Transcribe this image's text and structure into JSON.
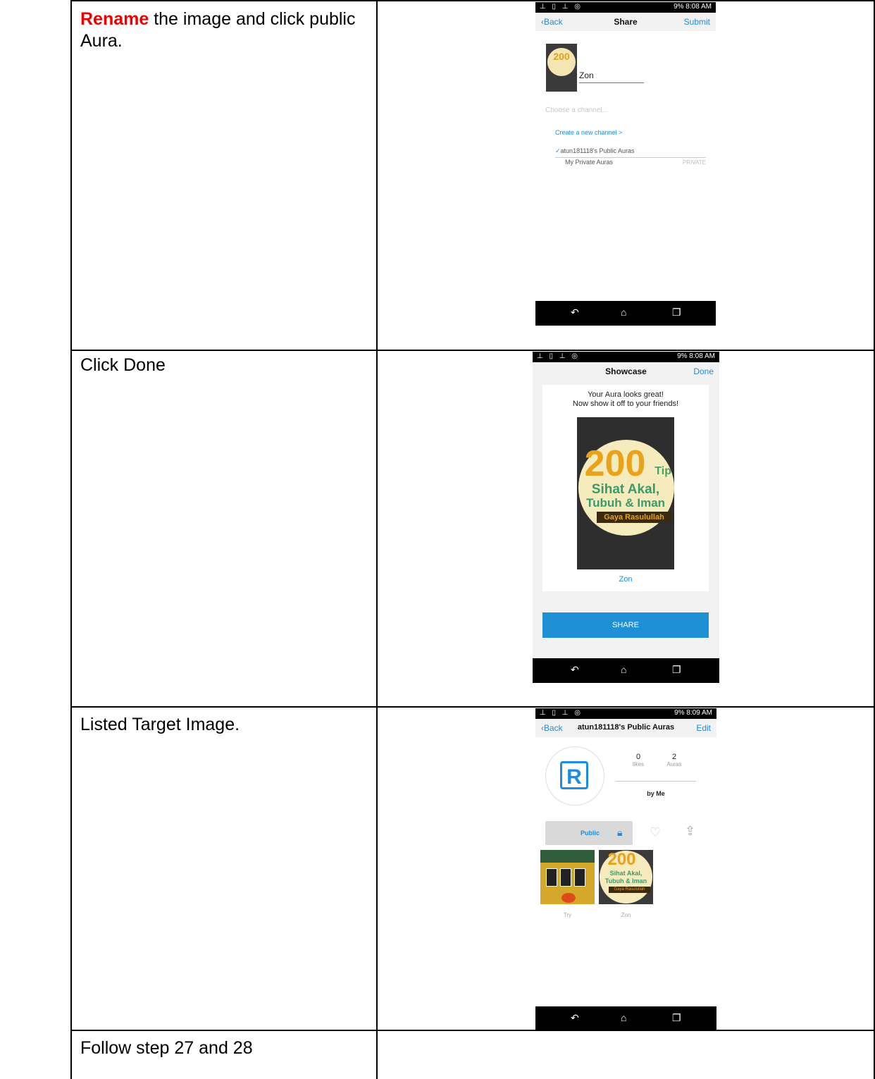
{
  "rows": [
    {
      "emph": "Rename",
      "text": " the image and click public Aura."
    },
    {
      "text": "Click Done"
    },
    {
      "text": "Listed Target Image."
    },
    {
      "text": "Follow step 27 and 28"
    }
  ],
  "screen1": {
    "status_time": "9%  8:08 AM",
    "back": "Back",
    "title": "Share",
    "submit": "Submit",
    "name_value": "Zon",
    "channel_placeholder": "Choose a channel...",
    "create_channel": "Create a new channel >",
    "channel_public": "atun181118's Public Auras",
    "channel_private": "My Private Auras",
    "private_tag": "PRIVATE"
  },
  "screen2": {
    "status_time": "9%  8:08 AM",
    "title": "Showcase",
    "done": "Done",
    "msg_line1": "Your Aura looks great!",
    "msg_line2": "Now show it off to your friends!",
    "cover_num": "200",
    "cover_tip": "Tip",
    "cover_line1": "Sihat Akal,",
    "cover_line2": "Tubuh & Iman",
    "cover_line3": "Gaya Rasulullah",
    "caption": "Zon",
    "share": "SHARE"
  },
  "screen3": {
    "status_time": "9%  8:09 AM",
    "back": "Back",
    "title": "atun181118's Public Auras",
    "edit": "Edit",
    "likes_count": "0",
    "likes_label": "likes",
    "auras_count": "2",
    "auras_label": "Auras",
    "by": "by Me",
    "public": "Public",
    "thumb1_caption": "Try",
    "thumb2_caption": "Zon"
  },
  "colors": {
    "accent": "#1e8ce0",
    "share_button": "#1e90d6",
    "emphasis": "#e00000"
  },
  "icons": [
    "back-chevron-icon",
    "checkmark-icon",
    "lock-icon",
    "heart-icon",
    "share-icon",
    "back-nav-icon",
    "home-nav-icon",
    "recents-nav-icon"
  ]
}
